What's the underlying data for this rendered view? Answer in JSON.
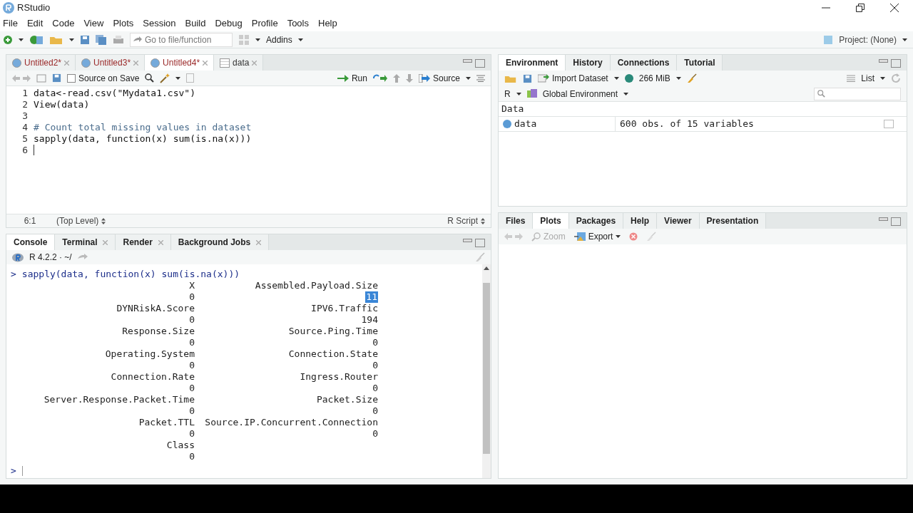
{
  "window": {
    "title": "RStudio"
  },
  "menu": [
    "File",
    "Edit",
    "Code",
    "View",
    "Plots",
    "Session",
    "Build",
    "Debug",
    "Profile",
    "Tools",
    "Help"
  ],
  "toolbar": {
    "goto_placeholder": "Go to file/function",
    "addins": "Addins",
    "project": "Project: (None)"
  },
  "editor": {
    "tabs": [
      {
        "label": "Untitled2*",
        "kind": "script",
        "selected": false
      },
      {
        "label": "Untitled3*",
        "kind": "script",
        "selected": false
      },
      {
        "label": "Untitled4*",
        "kind": "script",
        "selected": true
      },
      {
        "label": "data",
        "kind": "table",
        "selected": false
      }
    ],
    "source_on_save": {
      "label": "Source on Save",
      "checked": false
    },
    "run": "Run",
    "source": "Source",
    "lines": [
      {
        "number": "1",
        "kind": "code",
        "text": "data<-read.csv(\"Mydata1.csv\")"
      },
      {
        "number": "2",
        "kind": "code",
        "text": "View(data)"
      },
      {
        "number": "3",
        "kind": "code"
      },
      {
        "number": "4",
        "kind": "comment",
        "text": "# Count total missing values in dataset"
      },
      {
        "number": "5",
        "kind": "code",
        "text": "sapply(data, function(x) sum(is.na(x)))"
      },
      {
        "number": "6",
        "kind": "code"
      }
    ],
    "status": {
      "position": "6:1",
      "scope": "(Top Level)",
      "file_type": "R Script"
    }
  },
  "console": {
    "tabs": [
      {
        "label": "Console",
        "closable": false,
        "selected": true
      },
      {
        "label": "Terminal",
        "closable": true,
        "selected": false
      },
      {
        "label": "Render",
        "closable": true,
        "selected": false
      },
      {
        "label": "Background Jobs",
        "closable": true,
        "selected": false
      }
    ],
    "version": "R 4.2.2 · ~/",
    "prompt": ">",
    "command": "sapply(data, function(x) sum(is.na(x)))",
    "output": [
      {
        "names": [
          "X",
          "Assembled.Payload.Size"
        ],
        "values": [
          {
            "text": "0",
            "selected": false
          },
          {
            "text": "11",
            "selected": true
          }
        ]
      },
      {
        "names": [
          "DYNRiskA.Score",
          "IPV6.Traffic"
        ],
        "values": [
          {
            "text": "0",
            "selected": false
          },
          {
            "text": "194",
            "selected": false
          }
        ]
      },
      {
        "names": [
          "Response.Size",
          "Source.Ping.Time"
        ],
        "values": [
          {
            "text": "0",
            "selected": false
          },
          {
            "text": "0",
            "selected": false
          }
        ]
      },
      {
        "names": [
          "Operating.System",
          "Connection.State"
        ],
        "values": [
          {
            "text": "0",
            "selected": false
          },
          {
            "text": "0",
            "selected": false
          }
        ]
      },
      {
        "names": [
          "Connection.Rate",
          "Ingress.Router"
        ],
        "values": [
          {
            "text": "0",
            "selected": false
          },
          {
            "text": "0",
            "selected": false
          }
        ]
      },
      {
        "names": [
          "Server.Response.Packet.Time",
          "Packet.Size"
        ],
        "values": [
          {
            "text": "0",
            "selected": false
          },
          {
            "text": "0",
            "selected": false
          }
        ]
      },
      {
        "names": [
          "Packet.TTL",
          "Source.IP.Concurrent.Connection"
        ],
        "values": [
          {
            "text": "0",
            "selected": false
          },
          {
            "text": "0",
            "selected": false
          }
        ]
      },
      {
        "names": [
          "Class"
        ],
        "values": [
          {
            "text": "0",
            "selected": false
          }
        ]
      }
    ]
  },
  "environment": {
    "tabs": [
      {
        "label": "Environment",
        "selected": true
      },
      {
        "label": "History",
        "selected": false
      },
      {
        "label": "Connections",
        "selected": false
      },
      {
        "label": "Tutorial",
        "selected": false
      }
    ],
    "import_dataset": "Import Dataset",
    "memory": "266 MiB",
    "view_mode": "List",
    "language": "R",
    "scope": "Global Environment",
    "section": "Data",
    "rows": [
      {
        "name": "data",
        "value": "600 obs. of 15 variables"
      }
    ]
  },
  "files": {
    "tabs": [
      {
        "label": "Files",
        "selected": false
      },
      {
        "label": "Plots",
        "selected": true
      },
      {
        "label": "Packages",
        "selected": false
      },
      {
        "label": "Help",
        "selected": false
      },
      {
        "label": "Viewer",
        "selected": false
      },
      {
        "label": "Presentation",
        "selected": false
      }
    ],
    "zoom": "Zoom",
    "export": "Export"
  }
}
